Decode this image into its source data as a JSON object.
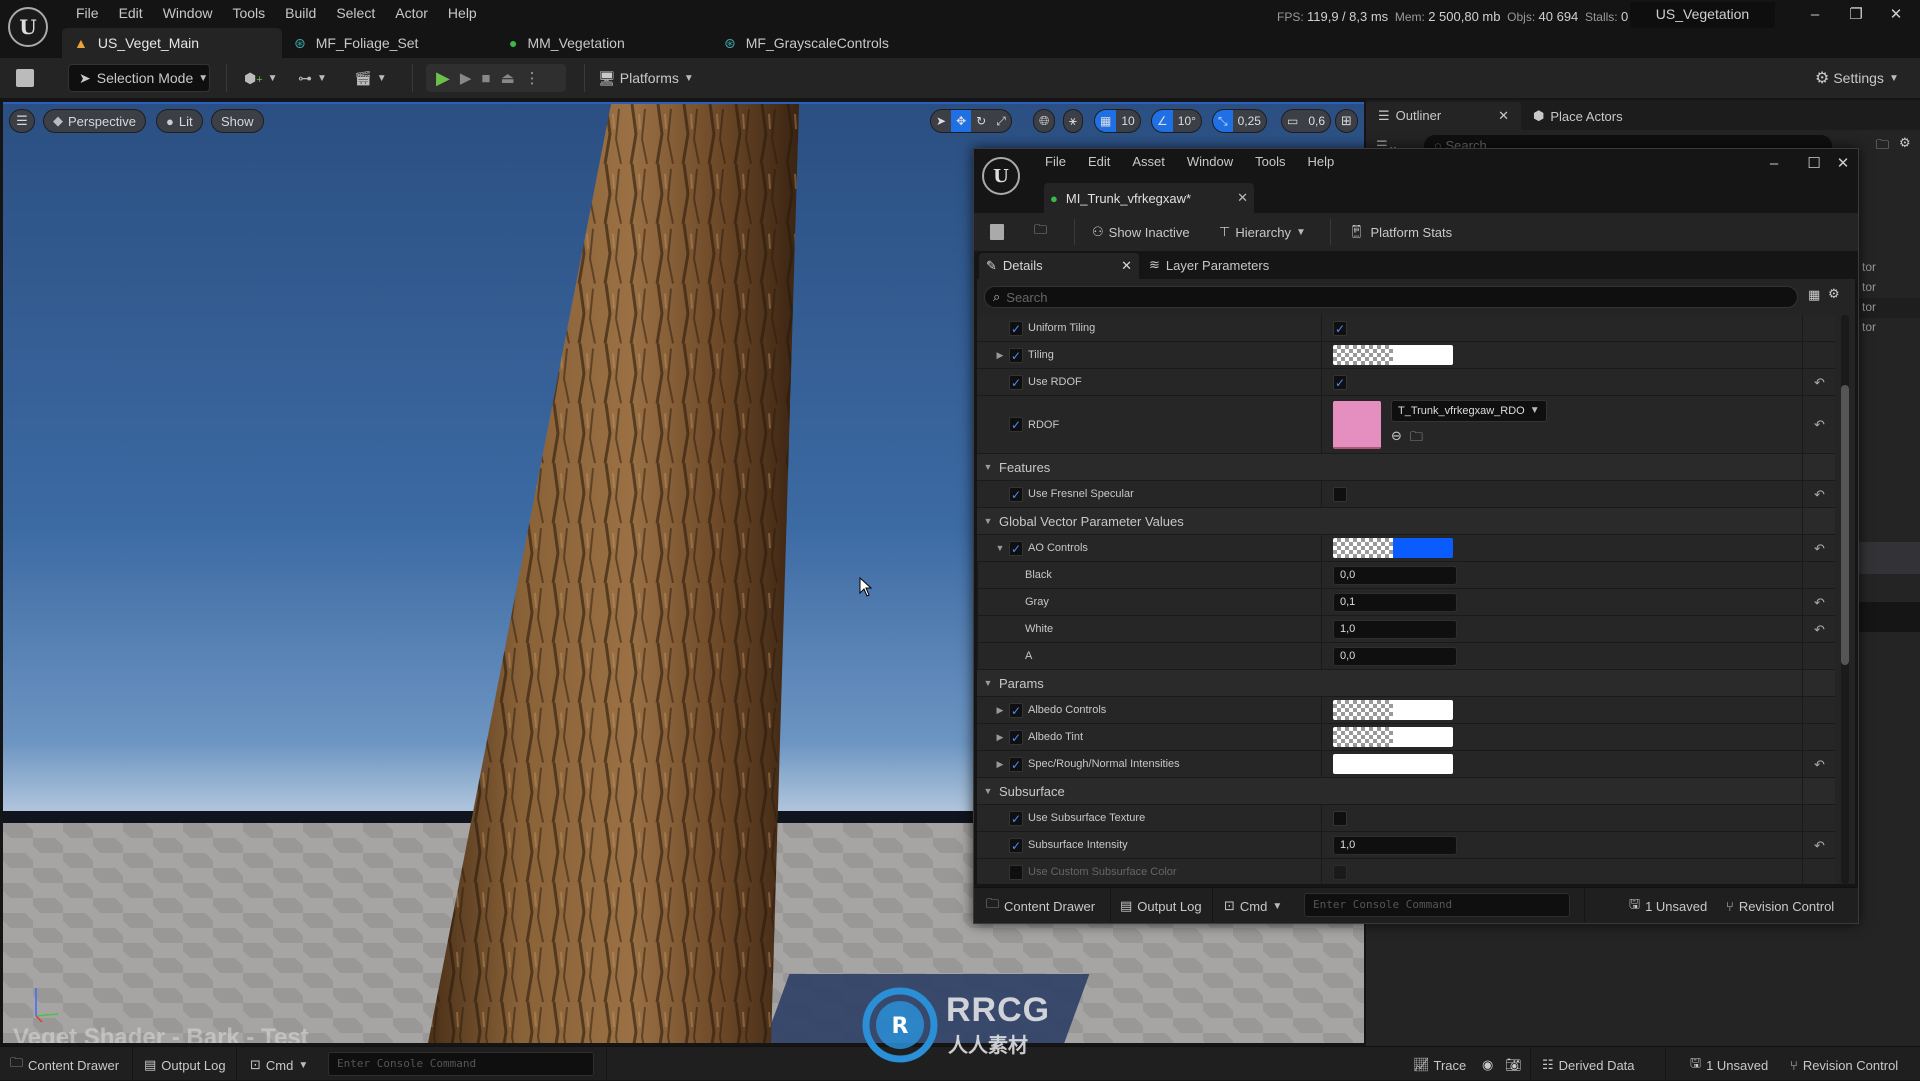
{
  "app": {
    "main_menu": [
      "File",
      "Edit",
      "Window",
      "Tools",
      "Build",
      "Select",
      "Actor",
      "Help"
    ],
    "stats": {
      "fps_label": "FPS:",
      "fps": "119,9",
      "frame_ms": "/ 8,3 ms",
      "mem_label": "Mem:",
      "mem": "2 500,80 mb",
      "objs_label": "Objs:",
      "objs": "40 694",
      "stalls_label": "Stalls:",
      "stalls": "0"
    },
    "project_name": "US_Vegetation",
    "window_controls": {
      "minimize": "–",
      "restore": "❐",
      "close": "✕"
    }
  },
  "doc_tabs": [
    {
      "label": "US_Veget_Main",
      "icon": "level-icon",
      "active": true
    },
    {
      "label": "MF_Foliage_Set",
      "icon": "material-function-icon",
      "active": false
    },
    {
      "label": "MM_Vegetation",
      "icon": "material-icon",
      "active": false
    },
    {
      "label": "MF_GrayscaleControls",
      "icon": "material-function-icon",
      "active": false
    }
  ],
  "toolbar": {
    "selection_mode": "Selection Mode",
    "platforms": "Platforms",
    "settings": "Settings"
  },
  "viewport": {
    "perspective": "Perspective",
    "lit": "Lit",
    "show": "Show",
    "grid_snap": "10",
    "rotation_snap": "10°",
    "scale_snap": "0,25",
    "camera_speed": "0,6",
    "overlay_label": "Veget Shader - Bark - Test",
    "colors": {
      "sky_top": "#2b4f82",
      "sky_horizon": "#dfe6ee",
      "floor": "#9a9896",
      "bark": "#7a5430"
    }
  },
  "outliner": {
    "tab_label": "Outliner",
    "place_actors": "Place Actors",
    "search_placeholder": "Search",
    "partial_rows": [
      "tor",
      "tor",
      "tor",
      "tor"
    ]
  },
  "mi_editor": {
    "menu": [
      "File",
      "Edit",
      "Asset",
      "Window",
      "Tools",
      "Help"
    ],
    "tab_label": "MI_Trunk_vfrkegxaw*",
    "toolbar": {
      "show_inactive": "Show Inactive",
      "hierarchy": "Hierarchy",
      "platform_stats": "Platform Stats"
    },
    "panel_tabs": {
      "details": "Details",
      "layer_parameters": "Layer Parameters"
    },
    "search_placeholder": "Search",
    "properties": [
      {
        "kind": "prop",
        "name": "Uniform Tiling",
        "checked": true,
        "expander": "none",
        "value_type": "bool",
        "value": true,
        "reset": false
      },
      {
        "kind": "prop",
        "name": "Tiling",
        "checked": true,
        "expander": "collapsed",
        "value_type": "color",
        "color": "#ffffff",
        "reset": false
      },
      {
        "kind": "prop",
        "name": "Use RDOF",
        "checked": true,
        "expander": "none",
        "value_type": "bool",
        "value": true,
        "reset": true
      },
      {
        "kind": "texture",
        "name": "RDOF",
        "checked": true,
        "expander": "none",
        "value_type": "texture",
        "texture": "T_Trunk_vfrkegxaw_RDO",
        "thumb_color": "#e48fc0",
        "reset": true
      },
      {
        "kind": "category",
        "name": "Features"
      },
      {
        "kind": "prop",
        "name": "Use Fresnel Specular",
        "checked": true,
        "expander": "none",
        "value_type": "bool",
        "value": false,
        "reset": true
      },
      {
        "kind": "category",
        "name": "Global Vector Parameter Values"
      },
      {
        "kind": "prop",
        "name": "AO Controls",
        "checked": true,
        "expander": "expanded",
        "value_type": "color",
        "color": "#0a5cff",
        "reset": true
      },
      {
        "kind": "sub",
        "name": "Black",
        "value": "0,0",
        "reset": false
      },
      {
        "kind": "sub",
        "name": "Gray",
        "value": "0,1",
        "reset": true
      },
      {
        "kind": "sub",
        "name": "White",
        "value": "1,0",
        "reset": true
      },
      {
        "kind": "sub",
        "name": "A",
        "value": "0,0",
        "reset": false
      },
      {
        "kind": "category",
        "name": "Params"
      },
      {
        "kind": "prop",
        "name": "Albedo Controls",
        "checked": true,
        "expander": "collapsed",
        "value_type": "color",
        "color": "#ffffff",
        "reset": false
      },
      {
        "kind": "prop",
        "name": "Albedo Tint",
        "checked": true,
        "expander": "collapsed",
        "value_type": "color",
        "color": "#ffffff",
        "reset": false
      },
      {
        "kind": "prop",
        "name": "Spec/Rough/Normal Intensities",
        "checked": true,
        "expander": "collapsed",
        "value_type": "color_solid",
        "color": "#ffffff",
        "reset": true
      },
      {
        "kind": "category",
        "name": "Subsurface"
      },
      {
        "kind": "prop",
        "name": "Use Subsurface Texture",
        "checked": true,
        "expander": "none",
        "value_type": "bool",
        "value": false,
        "reset": false
      },
      {
        "kind": "prop",
        "name": "Subsurface Intensity",
        "checked": true,
        "expander": "none",
        "value_type": "number",
        "value": "1,0",
        "reset": true
      },
      {
        "kind": "prop",
        "name": "Use Custom Subsurface Color",
        "checked": false,
        "expander": "none",
        "value_type": "bool",
        "value": false,
        "reset": false,
        "disabled": true
      }
    ],
    "bottom_bar": {
      "content_drawer": "Content Drawer",
      "output_log": "Output Log",
      "cmd": "Cmd",
      "console_placeholder": "Enter Console Command",
      "unsaved": "1 Unsaved",
      "revision_control": "Revision Control"
    }
  },
  "statusbar": {
    "content_drawer": "Content Drawer",
    "output_log": "Output Log",
    "cmd": "Cmd",
    "console_placeholder": "Enter Console Command",
    "trace": "Trace",
    "derived_data": "Derived Data",
    "unsaved": "1 Unsaved",
    "revision_control": "Revision Control"
  },
  "watermark": {
    "brand": "RRCG",
    "sub": "人人素材"
  }
}
